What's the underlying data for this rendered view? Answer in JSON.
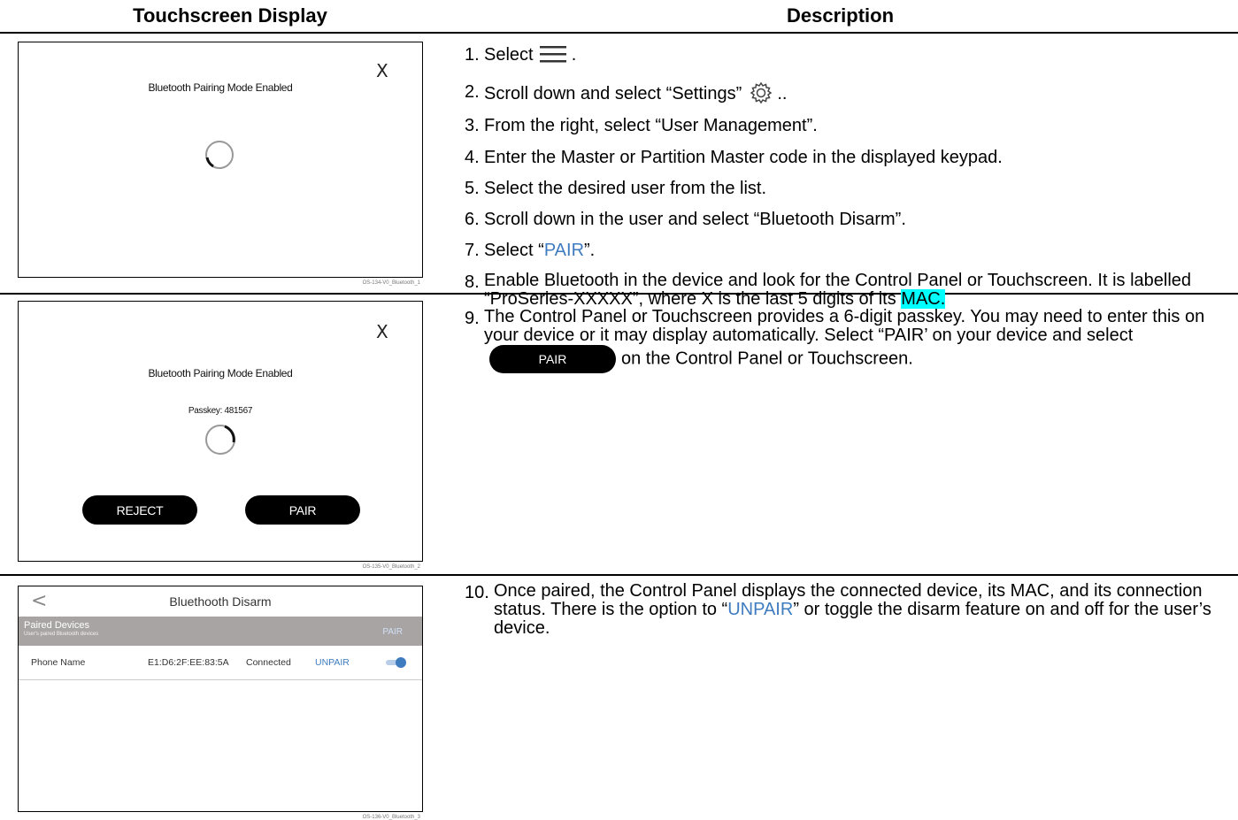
{
  "headers": {
    "left": "Touchscreen Display",
    "right": "Description"
  },
  "screen1": {
    "title": "Bluetooth Pairing Mode Enabled",
    "close_glyph": "X",
    "code": "OS-134-V0_Bluetooth_1"
  },
  "screen2": {
    "title": "Bluetooth Pairing Mode Enabled",
    "passkey": "Passkey: 481567",
    "close_glyph": "X",
    "reject_label": "REJECT",
    "pair_label": "PAIR",
    "code": "OS-135-V0_Bluetooth_2"
  },
  "screen3": {
    "back_glyph": "<",
    "title": "Bluethooth Disarm",
    "band_title": "Paired Devices",
    "band_sub": "User's paired Bluetooth devices",
    "band_pair": "PAIR",
    "row": {
      "name": "Phone Name",
      "mac": "E1:D6:2F:EE:83:5A",
      "status": "Connected",
      "unpair": "UNPAIR",
      "toggle_on": true
    },
    "code": "OS-136-V0_Bluetooth_3"
  },
  "steps": {
    "s1_num": "1.",
    "s1_text": "Select",
    "s2_num": "2.",
    "s2_text": "Scroll down and select “Settings”",
    "s3_num": "3.",
    "s3_text": "From the right, select “User Management”.",
    "s4_num": "4.",
    "s4_text": "Enter the Master or Partition Master code in the displayed keypad.",
    "s5_num": "5.",
    "s5_text": "Select the desired user from the list.",
    "s6_num": "6.",
    "s6_text": "Scroll down in the user and select “Bluetooth Disarm”.",
    "s7_num": "7.",
    "s7_pre": "Select “",
    "s7_link": "PAIR",
    "s7_post": "”.",
    "s8_num": "8.",
    "s8_text": "Enable Bluetooth in the device and look for the Control Panel or Touchscreen. It is labelled “ProSeries-XXXXX”, where X is the last 5 digits of its",
    "s8_mac": "MAC.",
    "s9_num": "9.",
    "s9_text": "The Control Panel or Touchscreen provides a 6-digit passkey.  You may need to enter this on your device or it may display automatically.  Select “PAIR’ on your device and select",
    "s9_pill": "PAIR",
    "s9_post": "on the Control Panel or Touchscreen.",
    "s10_num": "10.",
    "s10_pre": "Once paired, the Control Panel displays the connected device, its MAC, and its connection status.  There is the option to “",
    "s10_link": "UNPAIR",
    "s10_post": "” or toggle the disarm feature on and off for the user’s device."
  }
}
